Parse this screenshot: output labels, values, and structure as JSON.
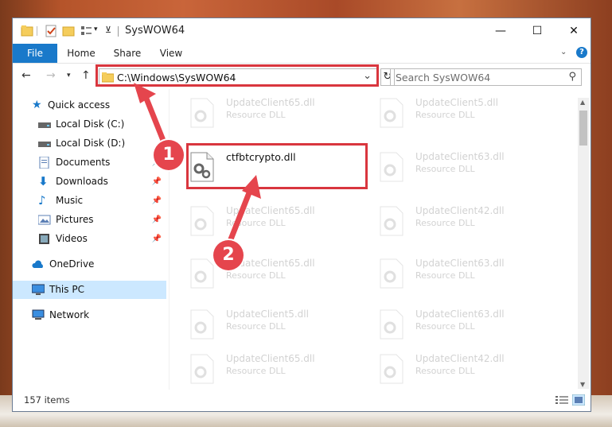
{
  "window": {
    "title": "SysWOW64"
  },
  "ribbon": {
    "tabs": [
      "File",
      "Home",
      "Share",
      "View"
    ]
  },
  "address": {
    "path": "C:\\Windows\\SysWOW64"
  },
  "search": {
    "placeholder": "Search SysWOW64"
  },
  "sidebar": {
    "items": [
      {
        "label": "Quick access",
        "icon": "star-icon"
      },
      {
        "label": "Local Disk (C:)",
        "icon": "drive-icon"
      },
      {
        "label": "Local Disk (D:)",
        "icon": "drive-icon"
      },
      {
        "label": "Documents",
        "icon": "documents-icon",
        "pinned": true
      },
      {
        "label": "Downloads",
        "icon": "download-icon",
        "pinned": true
      },
      {
        "label": "Music",
        "icon": "music-icon",
        "pinned": true
      },
      {
        "label": "Pictures",
        "icon": "pictures-icon",
        "pinned": true
      },
      {
        "label": "Videos",
        "icon": "videos-icon",
        "pinned": true
      },
      {
        "label": "OneDrive",
        "icon": "cloud-icon"
      },
      {
        "label": "This PC",
        "icon": "computer-icon",
        "selected": true
      },
      {
        "label": "Network",
        "icon": "network-icon"
      }
    ]
  },
  "files": {
    "highlighted": {
      "name": "ctfbtcrypto.dll"
    },
    "left_column": [
      {
        "name": "UpdateClient65.dll",
        "type": "Resource DLL"
      },
      {
        "name": "UpdateClient65.dll",
        "type": "Resource DLL"
      },
      {
        "name": "UpdateClient65.dll",
        "type": "Resource DLL"
      },
      {
        "name": "UpdateClient5.dll",
        "type": "Resource DLL"
      },
      {
        "name": "UpdateClient65.dll",
        "type": "Resource DLL"
      }
    ],
    "right_column": [
      {
        "name": "UpdateClient5.dll",
        "type": "Resource DLL"
      },
      {
        "name": "UpdateClient63.dll",
        "type": "Resource DLL"
      },
      {
        "name": "UpdateClient42.dll",
        "type": "Resource DLL"
      },
      {
        "name": "UpdateClient63.dll",
        "type": "Resource DLL"
      },
      {
        "name": "UpdateClient63.dll",
        "type": "Resource DLL"
      },
      {
        "name": "UpdateClient42.dll",
        "type": "Resource DLL"
      }
    ]
  },
  "status": {
    "items_count": "157 items"
  },
  "annotations": {
    "step1": "1",
    "step2": "2"
  },
  "colors": {
    "accent": "#1979ca",
    "highlight_red": "#d9363e",
    "badge_red": "#e5454d",
    "selected_bg": "#cce8ff"
  }
}
